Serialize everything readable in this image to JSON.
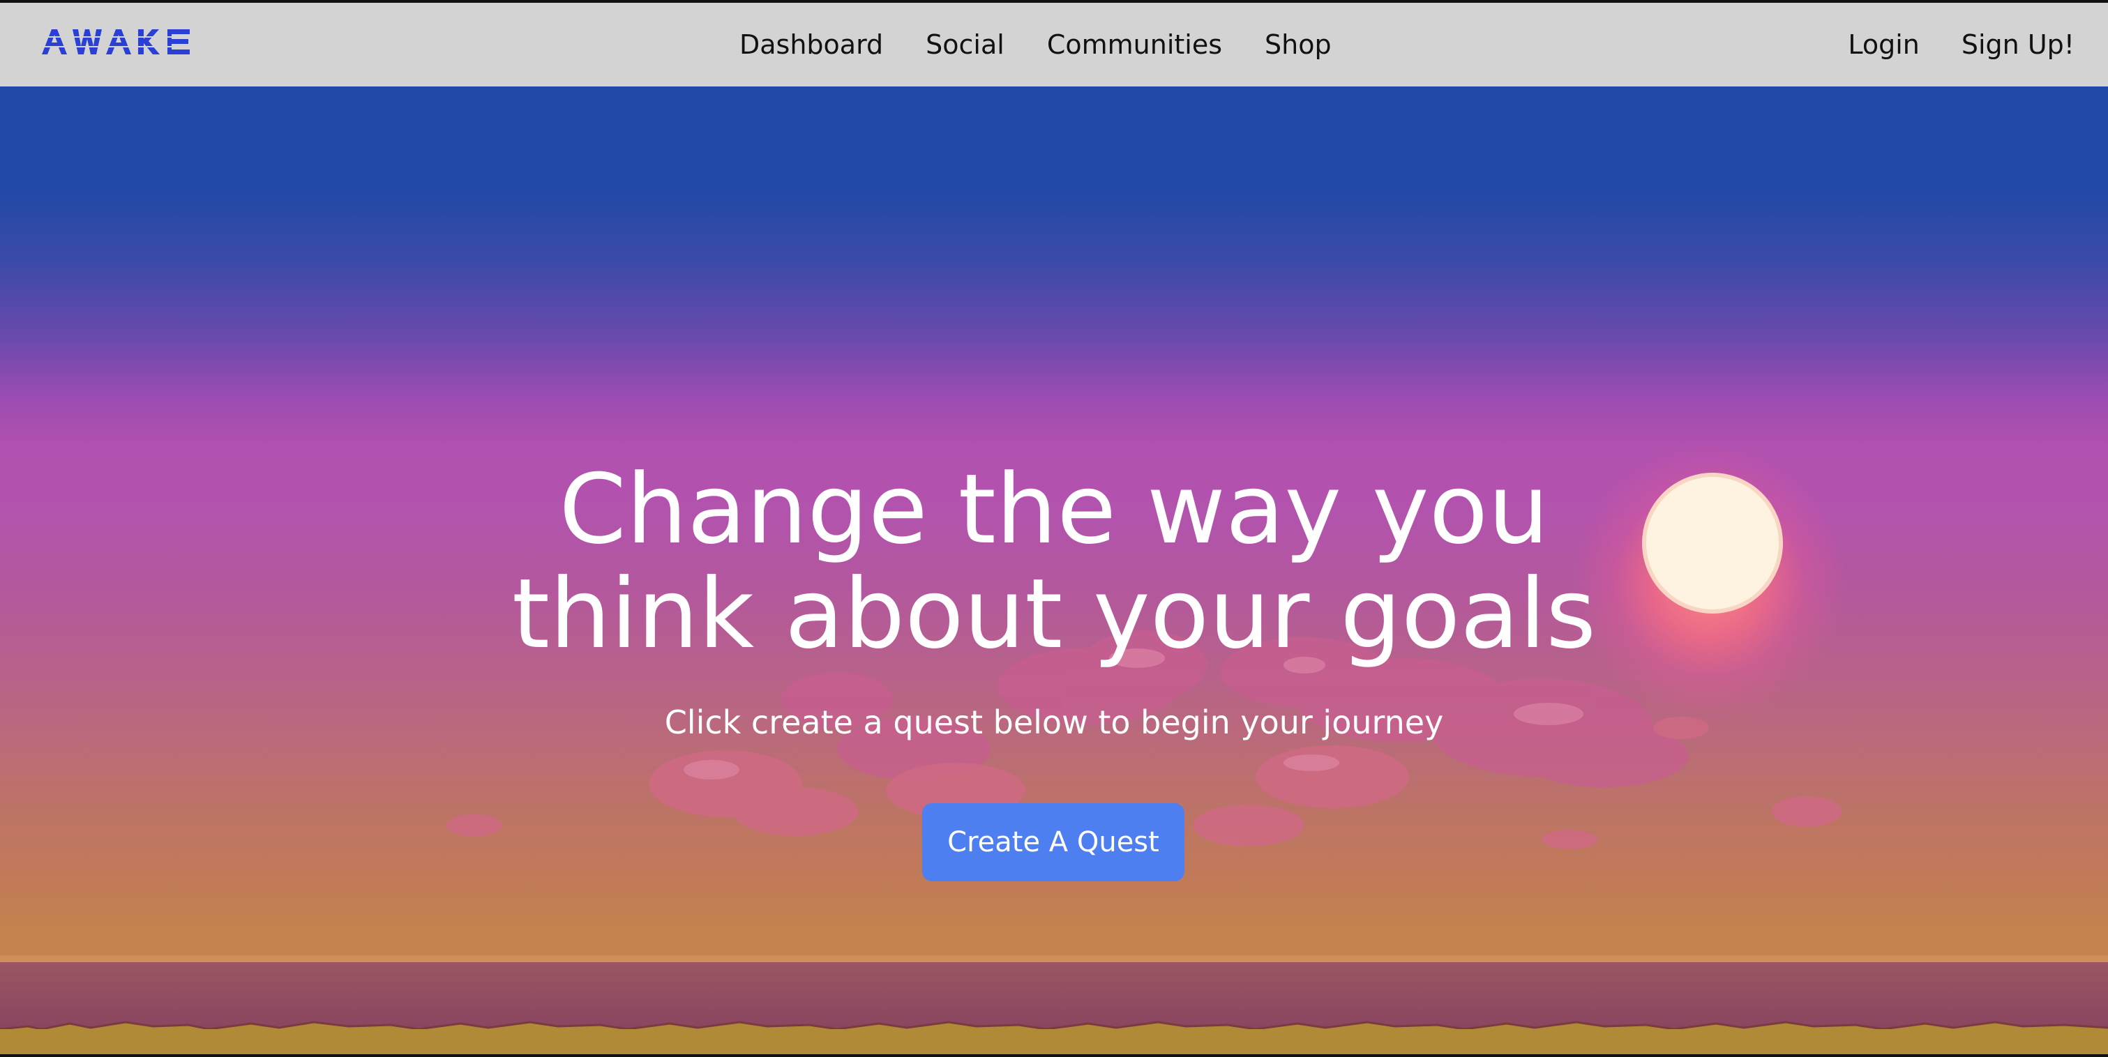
{
  "navbar": {
    "logo_text": "AWAKE",
    "links": [
      {
        "label": "Dashboard"
      },
      {
        "label": "Social"
      },
      {
        "label": "Communities"
      },
      {
        "label": "Shop"
      }
    ],
    "auth": {
      "login_label": "Login",
      "signup_label": "Sign Up!"
    }
  },
  "hero": {
    "headline_line1": "Change the way you",
    "headline_line2": "think about your goals",
    "subtitle": "Click create a quest below to begin your journey",
    "cta_label": "Create A Quest"
  },
  "colors": {
    "navbar_bg": "#d3d3d3",
    "logo": "#2a3fd6",
    "cta_bg": "#4d7ff0",
    "sky_top": "#2349a8",
    "sky_mid": "#b151b0",
    "sky_bottom": "#c4824f",
    "sun": "#fdf3e0"
  }
}
